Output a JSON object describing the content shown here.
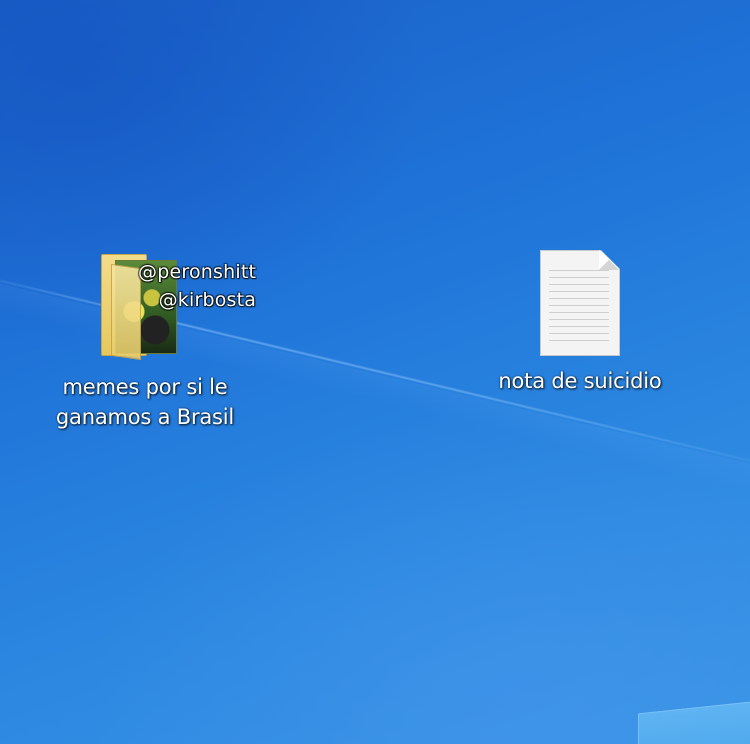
{
  "desktop": {
    "icons": [
      {
        "type": "folder",
        "label": "memes por si le\nganamos a Brasil",
        "icon": "folder-icon"
      },
      {
        "type": "text-document",
        "label": "nota de suicidio",
        "icon": "text-document-icon"
      }
    ],
    "watermark": {
      "line1": "@peronshitt",
      "line2": "@kirbosta"
    }
  },
  "colors": {
    "background": "#1f73d8",
    "label_text": "#ffffff"
  }
}
